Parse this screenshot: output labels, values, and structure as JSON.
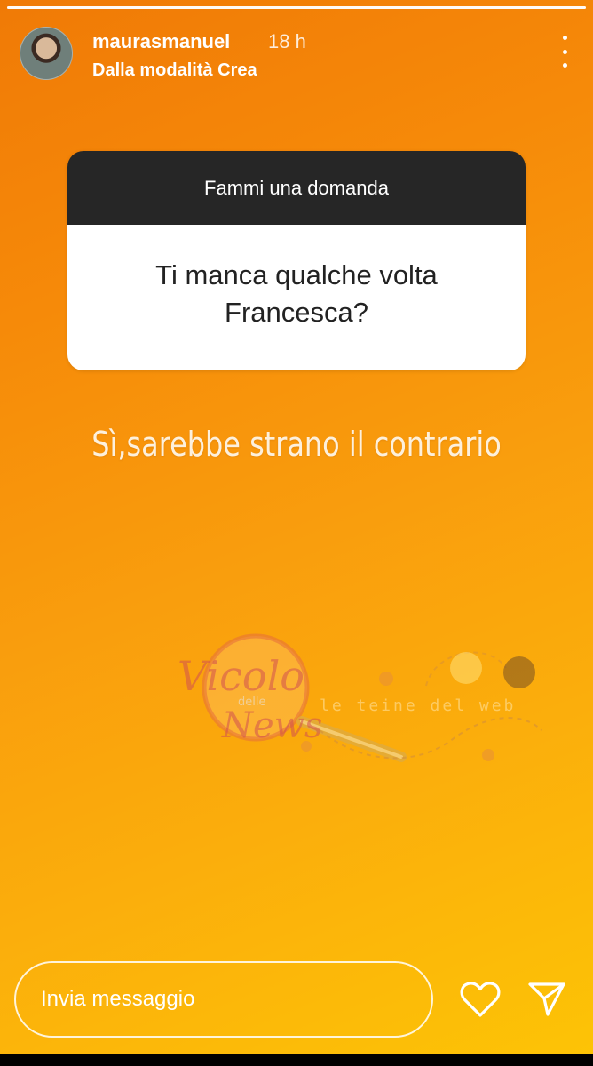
{
  "story": {
    "progress_fraction": 1.0
  },
  "header": {
    "username": "maurasmanuel",
    "time": "18 h",
    "subtitle": "Dalla modalità Crea"
  },
  "question_sticker": {
    "title": "Fammi una domanda",
    "question": "Ti manca qualche volta Francesca?"
  },
  "answer_text": "Sì,sarebbe strano il contrario",
  "watermark": {
    "main_text": "Vicolo delle News",
    "small_text": "le teine del web"
  },
  "reply": {
    "placeholder": "Invia messaggio"
  },
  "colors": {
    "gradient_start": "#f07a06",
    "gradient_end": "#fdc405",
    "sticker_header": "#262626"
  },
  "icons": {
    "more": "more-vertical-icon",
    "like": "heart-icon",
    "send": "send-icon"
  }
}
